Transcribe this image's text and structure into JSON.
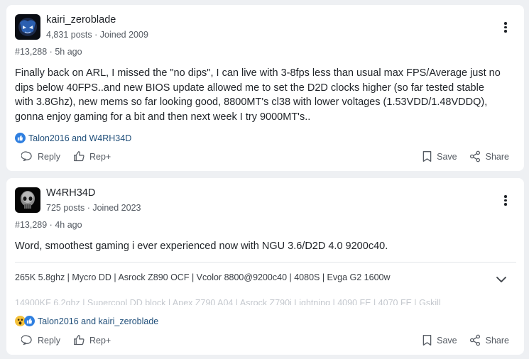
{
  "posts": [
    {
      "username": "kairi_zeroblade",
      "posts_count": "4,831 posts",
      "joined": "Joined 2009",
      "post_number": "#13,288",
      "time": "5h ago",
      "body_lines": [
        "Finally back on ARL, I missed the \"no dips\", I can live with 3-8fps less than usual max FPS/Average just no",
        "dips below 40FPS..and new BIOS update allowed me to set the D2D clocks higher (so far tested stable",
        "with 3.8Ghz), new mems so far looking good, 8800MT's cl38 with lower voltages (1.53VDD/1.48VDDQ),",
        "gonna enjoy gaming for a bit and then next week I try 9000MT's.."
      ],
      "reactions_text": "Talon2016 and W4RH34D",
      "reaction_icons": [
        "like-icon"
      ]
    },
    {
      "username": "W4RH34D",
      "posts_count": "725 posts",
      "joined": "Joined 2023",
      "post_number": "#13,289",
      "time": "4h ago",
      "body_lines": [
        "Word, smoothest gaming i ever experienced now with NGU 3.6/D2D 4.0 9200c40."
      ],
      "signature_line1": "265K 5.8ghz | Mycro DD | Asrock Z890 OCF | Vcolor 8800@9200c40 | 4080S | Evga G2 1600w",
      "signature_line2": "14900KF 6.2ghz | Supercool DD block | Apex Z790 A04 | Asrock Z790i Lightning | 4090 FE | 4070 FE | Gskill",
      "reactions_text": "Talon2016 and kairi_zeroblade",
      "reaction_icons": [
        "wow-icon",
        "like-icon"
      ]
    }
  ],
  "actions": {
    "reply": "Reply",
    "rep": "Rep+",
    "save": "Save",
    "share": "Share"
  },
  "separator": "·",
  "colors": {
    "background": "#eef0f3",
    "card": "#ffffff",
    "link": "#1f4e79",
    "like": "#2f7fe0"
  }
}
